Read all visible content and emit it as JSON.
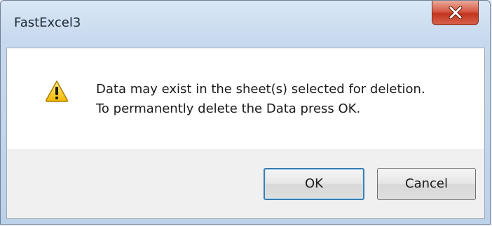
{
  "window": {
    "title": "FastExcel3"
  },
  "message": {
    "line1": "Data may exist in the sheet(s) selected for deletion.",
    "line2": "To permanently delete the Data press OK."
  },
  "buttons": {
    "ok_label": "OK",
    "cancel_label": "Cancel"
  },
  "icons": {
    "close": "close-icon",
    "warning": "warning-icon"
  },
  "colors": {
    "close_button": "#c3341f",
    "warning_yellow": "#f5c400",
    "default_button_border": "#3c7fb1"
  }
}
